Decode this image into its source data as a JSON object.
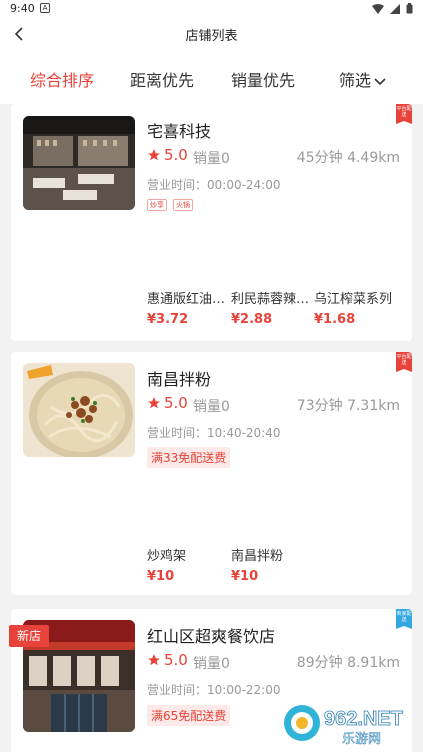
{
  "status_bar": {
    "time": "9:40",
    "notification_glyph": "A"
  },
  "header": {
    "title": "店铺列表"
  },
  "tabs": [
    {
      "label": "综合排序",
      "active": true
    },
    {
      "label": "距离优先",
      "active": false
    },
    {
      "label": "销量优先",
      "active": false
    },
    {
      "label": "筛选",
      "active": false
    }
  ],
  "stores": [
    {
      "name": "宅喜科技",
      "rating": "5.0",
      "sales": "销量0",
      "time": "45分钟",
      "distance": "4.49km",
      "hours": "营业时间：00:00-24:00",
      "tags": [
        "炒享",
        "火锅"
      ],
      "promo": "",
      "corner_badge": "平台配送",
      "dishes": [
        {
          "name": "惠通版红油…",
          "price": "¥3.72"
        },
        {
          "name": "利民蒜蓉辣…",
          "price": "¥2.88"
        },
        {
          "name": "乌江榨菜系列",
          "price": "¥1.68"
        }
      ]
    },
    {
      "name": "南昌拌粉",
      "rating": "5.0",
      "sales": "销量0",
      "time": "73分钟",
      "distance": "7.31km",
      "hours": "营业时间：10:40-20:40",
      "tags": [],
      "promo": "满33免配送费",
      "corner_badge": "平台配送",
      "dishes": [
        {
          "name": "炒鸡架",
          "price": "¥10"
        },
        {
          "name": "南昌拌粉",
          "price": "¥10"
        }
      ]
    },
    {
      "name": "红山区超爽餐饮店",
      "rating": "5.0",
      "sales": "销量0",
      "time": "89分钟",
      "distance": "8.91km",
      "hours": "营业时间：10:00-22:00",
      "tags": [],
      "promo": "满65免配送费",
      "corner_badge": "商家配送",
      "new_badge": "新店",
      "dishes": []
    }
  ],
  "watermark": {
    "text": "962.NET",
    "subtext": "乐游网"
  },
  "colors": {
    "accent": "#e8433a",
    "promo_bg": "#fde9e7",
    "merchant_badge": "#35a7e0"
  }
}
